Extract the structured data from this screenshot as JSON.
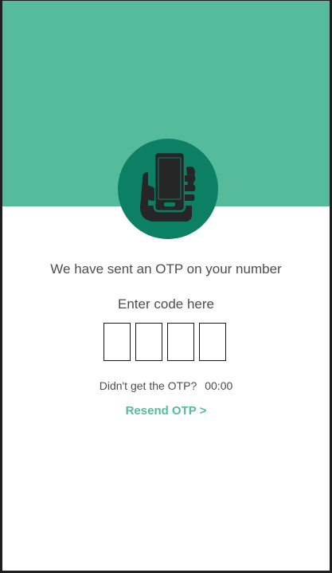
{
  "banner": {
    "color": "#55bb9b",
    "icon": "phone-in-hand-icon",
    "circle_color": "#0c8065"
  },
  "otp": {
    "message": "We have sent an OTP on your number",
    "prompt": "Enter code here",
    "digits": [
      "",
      "",
      "",
      ""
    ],
    "not_received": "Didn't get the OTP?",
    "timer": "00:00",
    "resend_label": "Resend OTP >"
  }
}
